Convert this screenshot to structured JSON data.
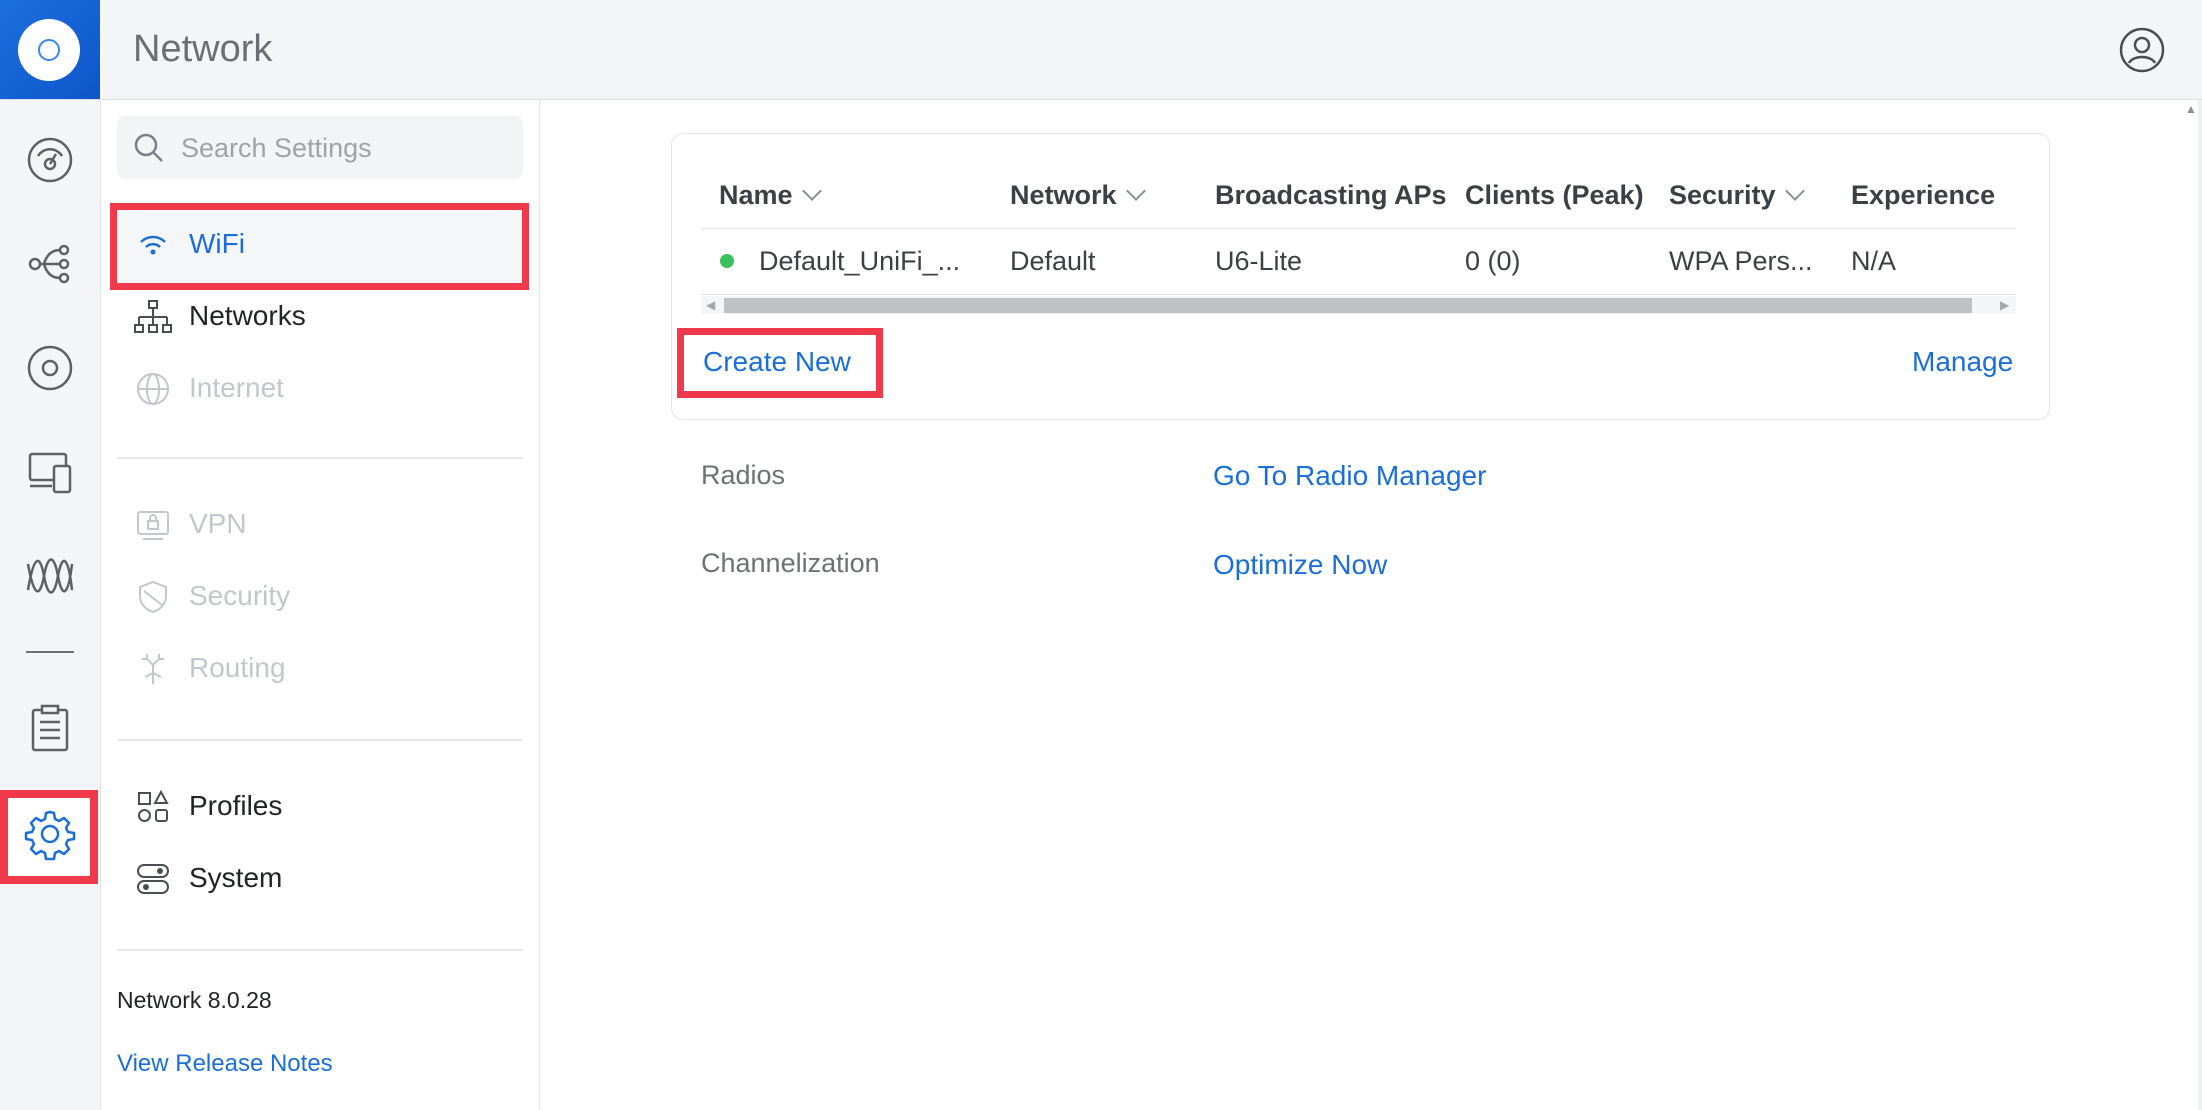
{
  "app": {
    "title": "Network"
  },
  "search": {
    "placeholder": "Search Settings"
  },
  "sidebar": {
    "items": [
      {
        "label": "WiFi",
        "state": "selected"
      },
      {
        "label": "Networks",
        "state": "enabled"
      },
      {
        "label": "Internet",
        "state": "disabled"
      },
      {
        "label": "VPN",
        "state": "disabled"
      },
      {
        "label": "Security",
        "state": "disabled"
      },
      {
        "label": "Routing",
        "state": "disabled"
      },
      {
        "label": "Profiles",
        "state": "enabled"
      },
      {
        "label": "System",
        "state": "enabled"
      }
    ],
    "version": "Network 8.0.28",
    "release_notes": "View Release Notes"
  },
  "rail": {
    "icons": [
      "dashboard-icon",
      "topology-icon",
      "devices-icon",
      "client-devices-icon",
      "insights-icon",
      "logs-icon",
      "settings-icon"
    ]
  },
  "wifi_table": {
    "columns": [
      "Name",
      "Network",
      "Broadcasting APs",
      "Clients (Peak)",
      "Security",
      "Experience"
    ],
    "rows": [
      {
        "status": "online",
        "name": "Default_UniFi_...",
        "network": "Default",
        "aps": "U6-Lite",
        "clients": "0 (0)",
        "security": "WPA Pers...",
        "experience": "N/A"
      }
    ],
    "create_new": "Create New",
    "manage": "Manage"
  },
  "settings_rows": [
    {
      "label": "Radios",
      "link": "Go To Radio Manager"
    },
    {
      "label": "Channelization",
      "link": "Optimize Now"
    }
  ],
  "colors": {
    "accent": "#1b6ed8",
    "highlight": "#f03a4c",
    "status_online": "#39c25b"
  }
}
